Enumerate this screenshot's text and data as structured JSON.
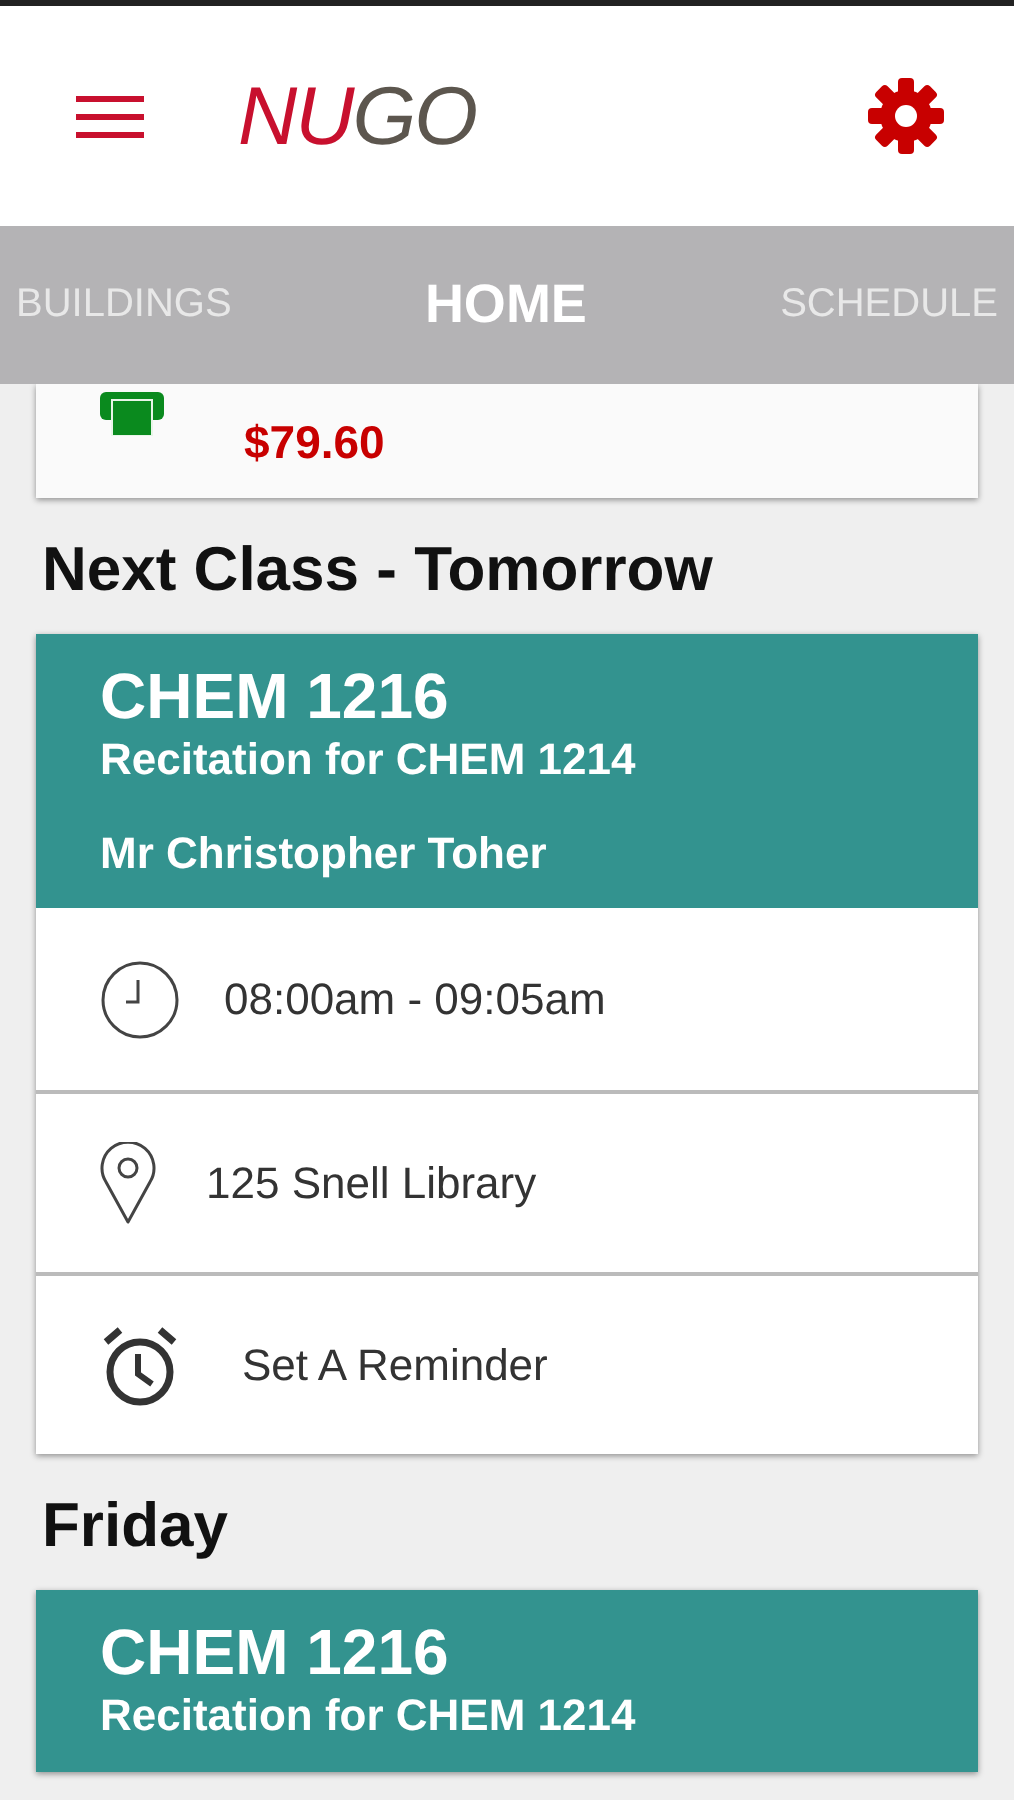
{
  "header": {
    "logo": {
      "part_1": "NU",
      "part_2": "GO"
    }
  },
  "tabs": [
    {
      "label": "BUILDINGS",
      "selected": false
    },
    {
      "label": "HOME",
      "selected": true
    },
    {
      "label": "SCHEDULE",
      "selected": false
    }
  ],
  "account_card": {
    "amount": "$79.60"
  },
  "sections": [
    {
      "heading": "Next Class - Tomorrow",
      "classes": [
        {
          "course": "CHEM 1216",
          "description": "Recitation for CHEM 1214",
          "instructor": "Mr Christopher Toher",
          "details": [
            {
              "kind": "time",
              "text": "08:00am - 09:05am"
            },
            {
              "kind": "location",
              "text": "125 Snell Library"
            },
            {
              "kind": "reminder",
              "text": "Set A Reminder"
            }
          ]
        }
      ]
    },
    {
      "heading": "Friday",
      "classes": [
        {
          "course": "CHEM 1216",
          "description": "Recitation for CHEM 1214"
        }
      ]
    }
  ]
}
